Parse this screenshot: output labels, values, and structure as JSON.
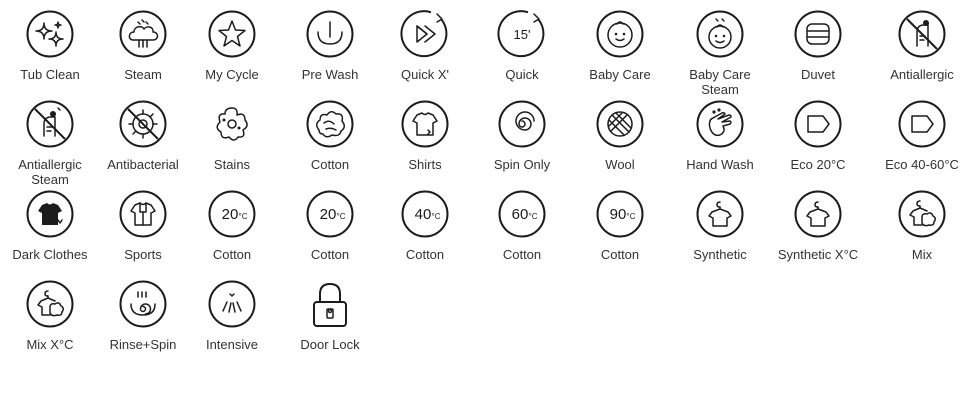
{
  "rows": [
    [
      {
        "id": "tub-clean",
        "label": "Tub Clean",
        "icon": "sparkles-icon"
      },
      {
        "id": "steam",
        "label": "Steam",
        "icon": "steam-cloud-icon"
      },
      {
        "id": "my-cycle",
        "label": "My Cycle",
        "icon": "star-icon"
      },
      {
        "id": "pre-wash",
        "label": "Pre Wash",
        "icon": "tub-drop-icon"
      },
      {
        "id": "quick-x",
        "label": "Quick X'",
        "icon": "fast-forward-icon"
      },
      {
        "id": "quick",
        "label": "Quick",
        "icon": "timer-15-icon",
        "value": "15'"
      },
      {
        "id": "baby-care",
        "label": "Baby Care",
        "icon": "baby-face-icon"
      },
      {
        "id": "baby-care-steam",
        "label": "Baby Care\nSteam",
        "icon": "baby-steam-icon"
      },
      {
        "id": "duvet",
        "label": "Duvet",
        "icon": "duvet-icon"
      },
      {
        "id": "antiallergic",
        "label": "Antiallergic",
        "icon": "no-mite-icon"
      }
    ],
    [
      {
        "id": "antiallergic-steam",
        "label": "Antiallergic\nSteam",
        "icon": "no-mite-steam-icon"
      },
      {
        "id": "antibacterial",
        "label": "Antibacterial",
        "icon": "no-bacteria-icon"
      },
      {
        "id": "stains",
        "label": "Stains",
        "icon": "stain-splat-icon"
      },
      {
        "id": "cotton",
        "label": "Cotton",
        "icon": "cotton-cloud-icon"
      },
      {
        "id": "shirts",
        "label": "Shirts",
        "icon": "shirt-icon"
      },
      {
        "id": "spin-only",
        "label": "Spin Only",
        "icon": "spiral-icon"
      },
      {
        "id": "wool",
        "label": "Wool",
        "icon": "yarn-ball-icon"
      },
      {
        "id": "hand-wash",
        "label": "Hand Wash",
        "icon": "hand-drops-icon"
      },
      {
        "id": "eco-20",
        "label": "Eco 20°C",
        "icon": "eco-tag-icon"
      },
      {
        "id": "eco-40-60",
        "label": "Eco 40-60°C",
        "icon": "eco-tag-icon"
      }
    ],
    [
      {
        "id": "dark-clothes",
        "label": "Dark Clothes",
        "icon": "dark-shirt-icon"
      },
      {
        "id": "sports",
        "label": "Sports",
        "icon": "sport-shirt-icon"
      },
      {
        "id": "cotton-20a",
        "label": "Cotton",
        "icon": "temp-badge-icon",
        "value": "20",
        "unit": "°C"
      },
      {
        "id": "cotton-20b",
        "label": "Cotton",
        "icon": "temp-badge-icon",
        "value": "20",
        "unit": "°C"
      },
      {
        "id": "cotton-40",
        "label": "Cotton",
        "icon": "temp-badge-icon",
        "value": "40",
        "unit": "°C"
      },
      {
        "id": "cotton-60",
        "label": "Cotton",
        "icon": "temp-badge-icon",
        "value": "60",
        "unit": "°C"
      },
      {
        "id": "cotton-90",
        "label": "Cotton",
        "icon": "temp-badge-icon",
        "value": "90",
        "unit": "°C"
      },
      {
        "id": "synthetic",
        "label": "Synthetic",
        "icon": "hanger-shirt-icon"
      },
      {
        "id": "synthetic-x",
        "label": "Synthetic X°C",
        "icon": "hanger-shirt-icon"
      },
      {
        "id": "mix",
        "label": "Mix",
        "icon": "hanger-mix-icon"
      }
    ],
    [
      {
        "id": "mix-x",
        "label": "Mix X°C",
        "icon": "hanger-mix-icon"
      },
      {
        "id": "rinse-spin",
        "label": "Rinse+Spin",
        "icon": "rinse-spin-icon"
      },
      {
        "id": "intensive",
        "label": "Intensive",
        "icon": "intensive-spray-icon"
      },
      {
        "id": "door-lock",
        "label": "Door Lock",
        "icon": "padlock-icon"
      }
    ]
  ]
}
